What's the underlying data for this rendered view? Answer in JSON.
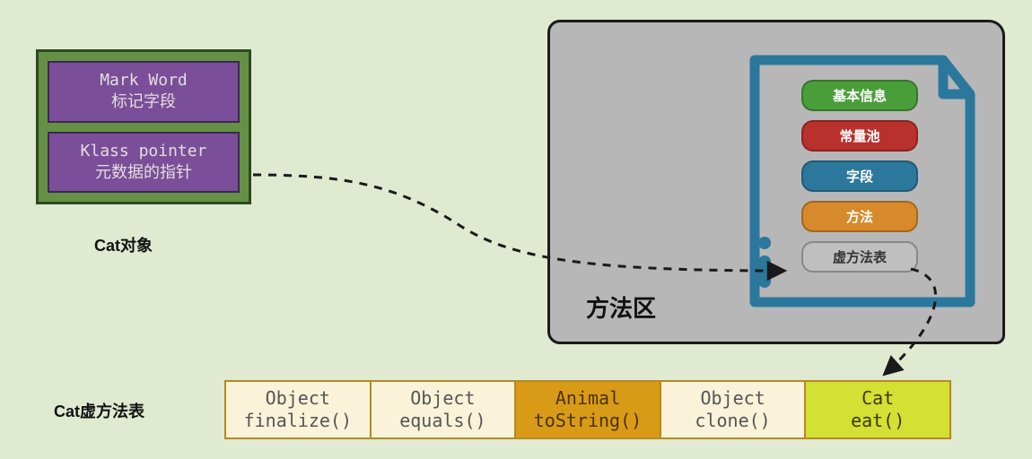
{
  "object": {
    "mark_word_en": "Mark Word",
    "mark_word_cn": "标记字段",
    "klass_ptr_en": "Klass pointer",
    "klass_ptr_cn": "元数据的指针",
    "label": "Cat对象"
  },
  "method_area": {
    "label": "方法区",
    "pills": {
      "basic": "基本信息",
      "const": "常量池",
      "field": "字段",
      "method": "方法",
      "vtable": "虚方法表"
    }
  },
  "vtable": {
    "label": "Cat虚方法表",
    "cells": [
      {
        "cls": "Object",
        "method": "finalize()"
      },
      {
        "cls": "Object",
        "method": "equals()"
      },
      {
        "cls": "Animal",
        "method": "toString()"
      },
      {
        "cls": "Object",
        "method": "clone()"
      },
      {
        "cls": "Cat",
        "method": "eat()"
      }
    ]
  },
  "colors": {
    "dash": "#1a1a1a"
  }
}
